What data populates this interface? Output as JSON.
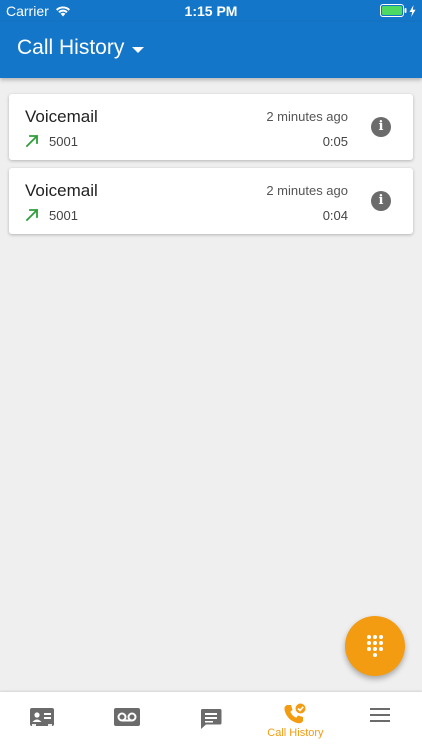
{
  "status_bar": {
    "carrier": "Carrier",
    "time": "1:15 PM"
  },
  "app_bar": {
    "title": "Call History"
  },
  "calls": [
    {
      "name": "Voicemail",
      "time_ago": "2 minutes ago",
      "number": "5001",
      "duration": "0:05",
      "direction": "outgoing"
    },
    {
      "name": "Voicemail",
      "time_ago": "2 minutes ago",
      "number": "5001",
      "duration": "0:04",
      "direction": "outgoing"
    }
  ],
  "bottom_nav": {
    "items": [
      {
        "icon": "contacts-icon",
        "label": ""
      },
      {
        "icon": "voicemail-icon",
        "label": ""
      },
      {
        "icon": "messages-icon",
        "label": ""
      },
      {
        "icon": "call-history-icon",
        "label": "Call History",
        "active": true
      },
      {
        "icon": "menu-icon",
        "label": ""
      }
    ]
  },
  "colors": {
    "primary": "#1476c8",
    "accent": "#f39c12",
    "outgoing": "#2e9e3a",
    "background": "#efefef",
    "battery": "#4cd964"
  }
}
